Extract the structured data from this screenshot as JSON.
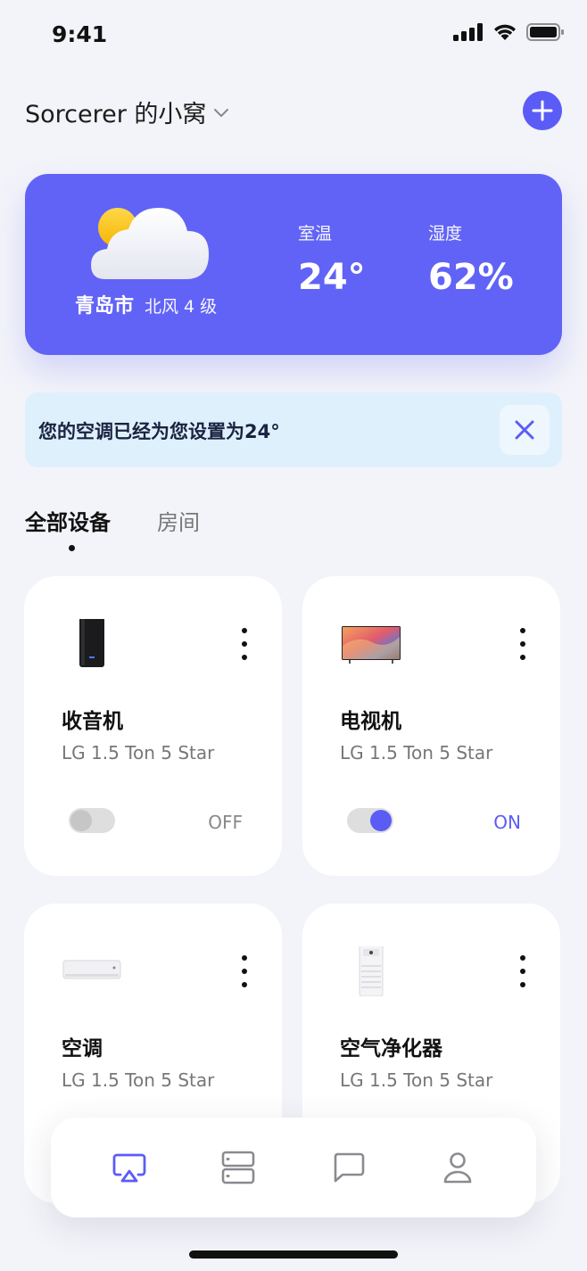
{
  "status": {
    "time": "9:41"
  },
  "header": {
    "home_name": "Sorcerer 的小窝"
  },
  "weather": {
    "city": "青岛市",
    "wind": "北风 4 级",
    "temp_label": "室温",
    "temp_value": "24°",
    "humidity_label": "湿度",
    "humidity_value": "62%"
  },
  "notice": {
    "text": "您的空调已经为您设置为24°"
  },
  "tabs": {
    "all": "全部设备",
    "room": "房间"
  },
  "devices": [
    {
      "name": "收音机",
      "model": "LG 1.5 Ton 5 Star",
      "state": "OFF"
    },
    {
      "name": "电视机",
      "model": "LG 1.5 Ton 5 Star",
      "state": "ON"
    },
    {
      "name": "空调",
      "model": "LG 1.5 Ton 5 Star",
      "state": ""
    },
    {
      "name": "空气净化器",
      "model": "LG 1.5 Ton 5 Star",
      "state": ""
    }
  ],
  "colors": {
    "accent": "#5b5cf6",
    "weather_bg": "#6163f6",
    "notice_bg": "#dff0fd",
    "page_bg": "#f3f4f9"
  },
  "icons": {
    "tabbar": [
      "airplay-icon",
      "server-icon",
      "message-icon",
      "user-icon"
    ]
  }
}
